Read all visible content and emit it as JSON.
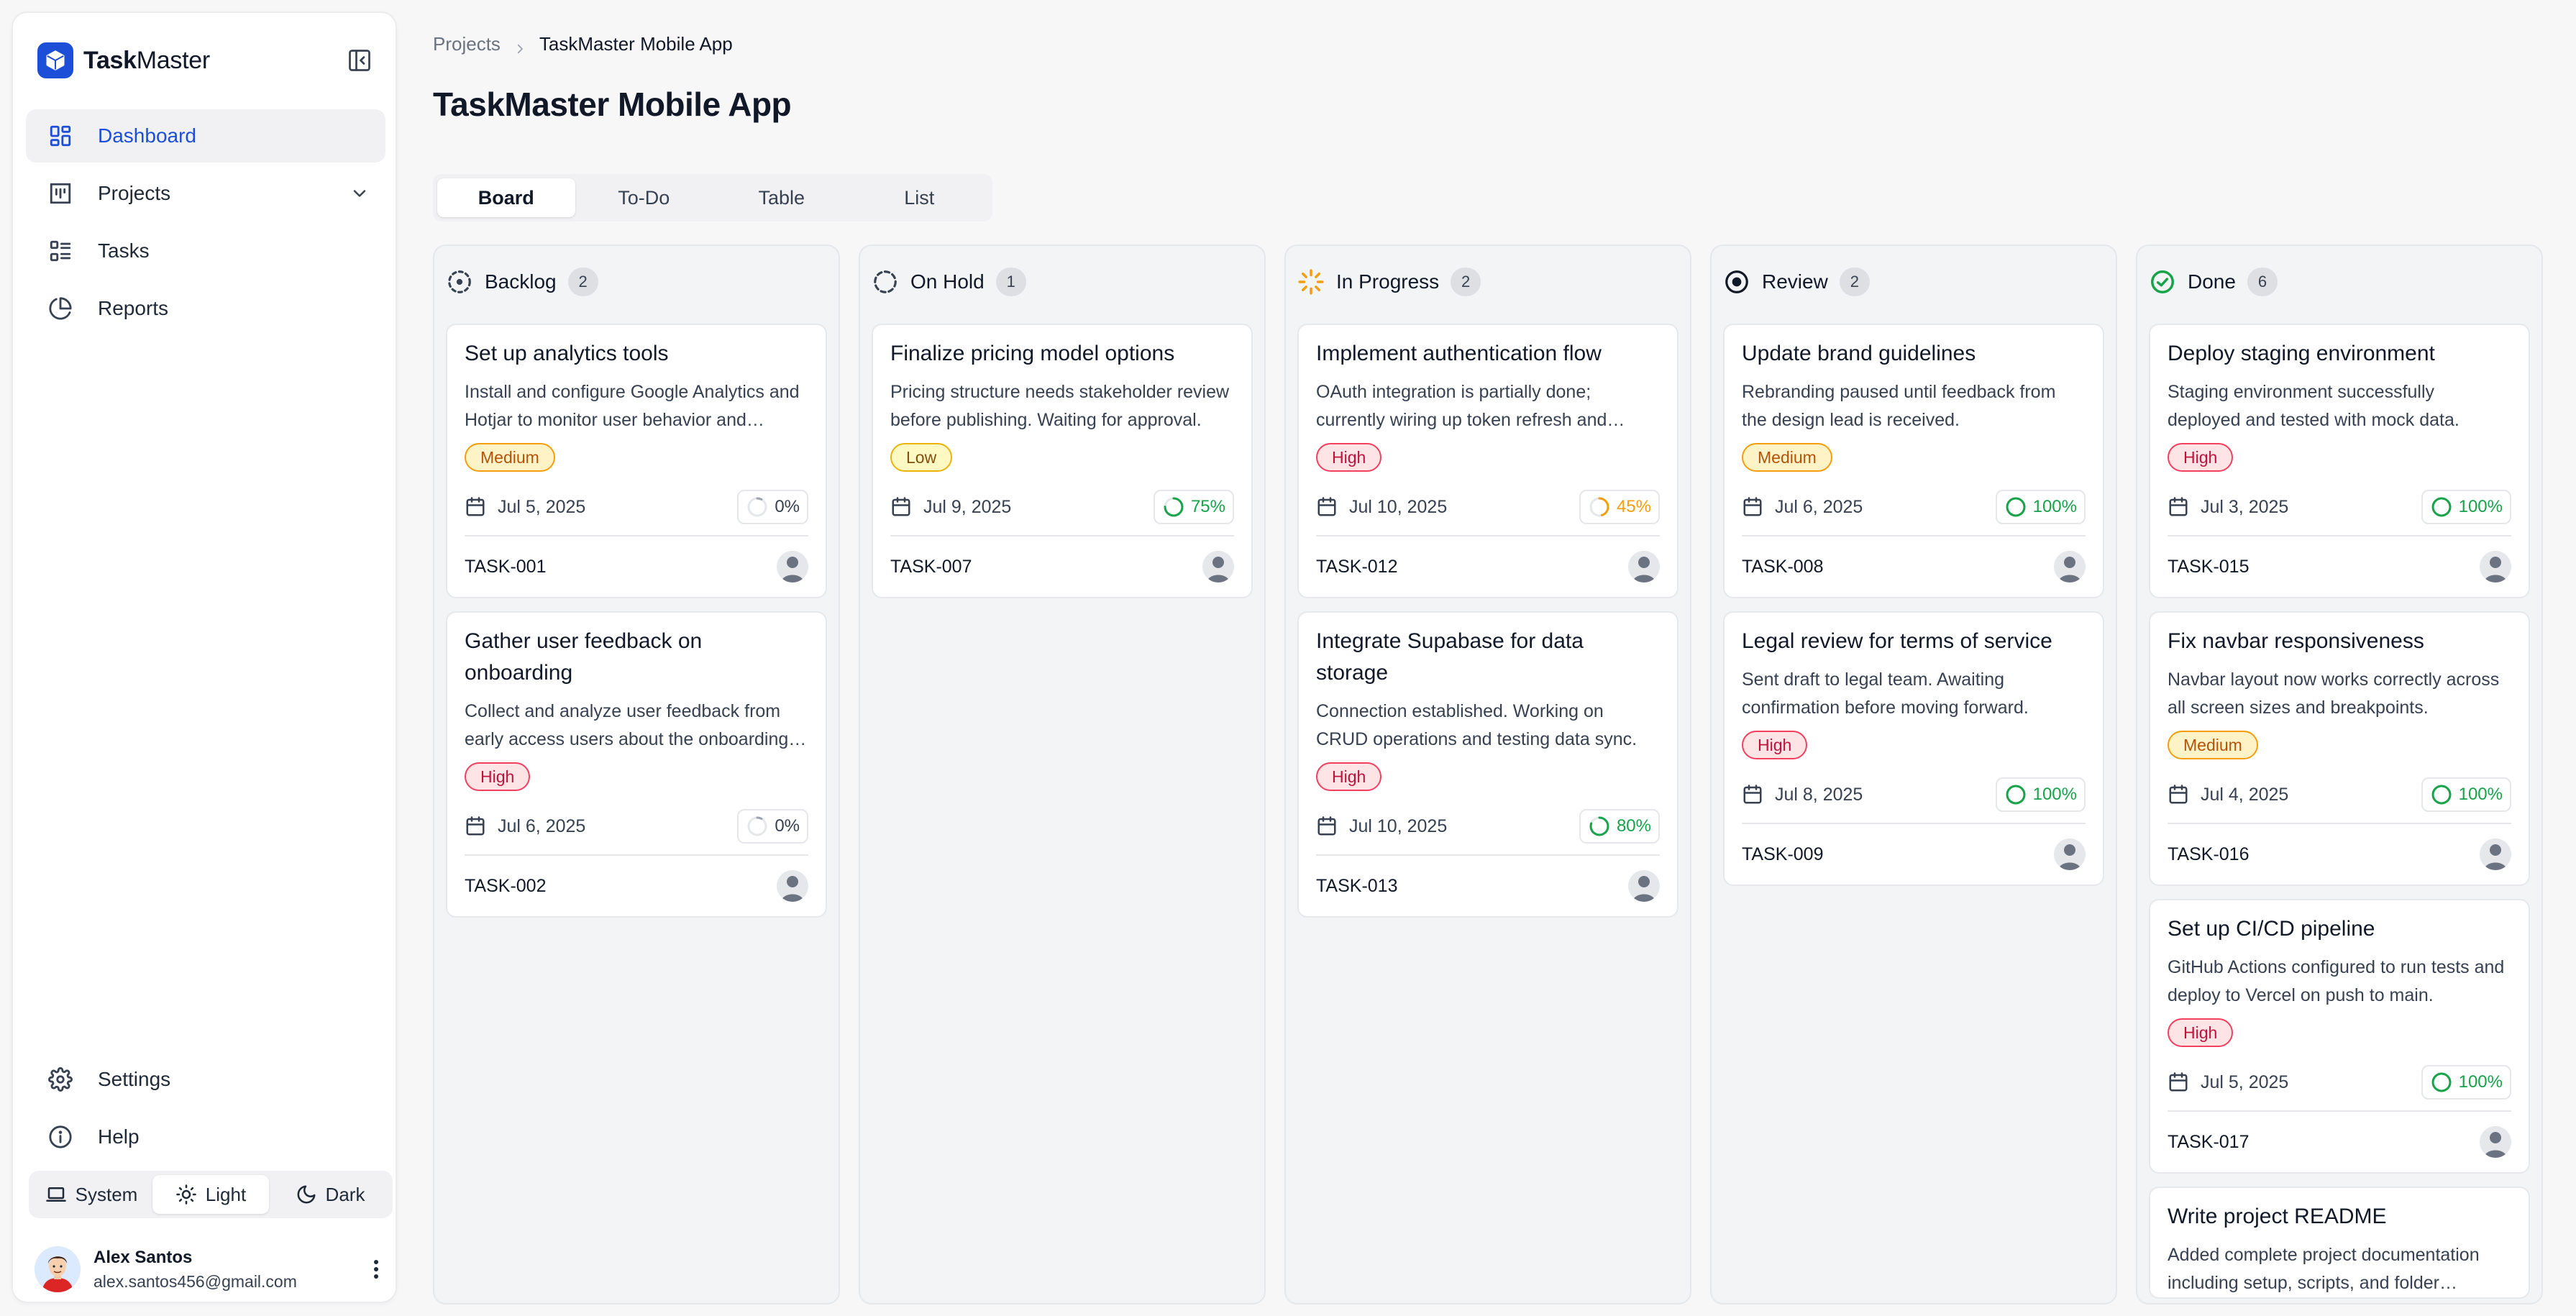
{
  "app": {
    "name_bold": "Task",
    "name_rest": "Master",
    "brand_color": "#1d4ed8"
  },
  "sidebar": {
    "items": [
      {
        "label": "Dashboard",
        "icon": "dashboard-icon",
        "active": true
      },
      {
        "label": "Projects",
        "icon": "projects-icon",
        "expandable": true
      },
      {
        "label": "Tasks",
        "icon": "tasks-icon"
      },
      {
        "label": "Reports",
        "icon": "reports-icon"
      }
    ],
    "bottom_items": [
      {
        "label": "Settings",
        "icon": "gear-icon"
      },
      {
        "label": "Help",
        "icon": "info-icon"
      }
    ],
    "theme": {
      "options": [
        "System",
        "Light",
        "Dark"
      ],
      "selected": "Light"
    },
    "user": {
      "name": "Alex Santos",
      "email": "alex.santos456@gmail.com"
    }
  },
  "breadcrumb": {
    "parent": "Projects",
    "current": "TaskMaster Mobile App"
  },
  "page": {
    "title": "TaskMaster Mobile App"
  },
  "tabs": [
    "Board",
    "To-Do",
    "Table",
    "List"
  ],
  "active_tab": "Board",
  "columns": [
    {
      "title": "Backlog",
      "count": "2",
      "status_icon": "backlog-icon",
      "cards": [
        {
          "title": "Set up analytics tools",
          "desc": "Install and configure Google Analytics and Hotjar to monitor user behavior and engagement metrics.",
          "priority": "Medium",
          "date": "Jul 5, 2025",
          "progress": "0%",
          "id": "TASK-001"
        },
        {
          "title": "Gather user feedback on onboarding",
          "desc": "Collect and analyze user feedback from early access users about the onboarding experience.",
          "priority": "High",
          "date": "Jul 6, 2025",
          "progress": "0%",
          "id": "TASK-002"
        }
      ]
    },
    {
      "title": "On Hold",
      "count": "1",
      "status_icon": "on-hold-icon",
      "cards": [
        {
          "title": "Finalize pricing model options",
          "desc": "Pricing structure needs stakeholder review before publishing. Waiting for approval.",
          "priority": "Low",
          "date": "Jul 9, 2025",
          "progress": "75%",
          "id": "TASK-007"
        }
      ]
    },
    {
      "title": "In Progress",
      "count": "2",
      "status_icon": "in-progress-icon",
      "cards": [
        {
          "title": "Implement authentication flow",
          "desc": "OAuth integration is partially done; currently wiring up token refresh and session handling.",
          "priority": "High",
          "date": "Jul 10, 2025",
          "progress": "45%",
          "id": "TASK-012"
        },
        {
          "title": "Integrate Supabase for data storage",
          "desc": "Connection established. Working on CRUD operations and testing data sync.",
          "priority": "High",
          "date": "Jul 10, 2025",
          "progress": "80%",
          "id": "TASK-013"
        }
      ]
    },
    {
      "title": "Review",
      "count": "2",
      "status_icon": "review-icon",
      "cards": [
        {
          "title": "Update brand guidelines",
          "desc": "Rebranding paused until feedback from the design lead is received.",
          "priority": "Medium",
          "date": "Jul 6, 2025",
          "progress": "100%",
          "id": "TASK-008"
        },
        {
          "title": "Legal review for terms of service",
          "desc": "Sent draft to legal team. Awaiting confirmation before moving forward.",
          "priority": "High",
          "date": "Jul 8, 2025",
          "progress": "100%",
          "id": "TASK-009"
        }
      ]
    },
    {
      "title": "Done",
      "count": "6",
      "status_icon": "done-icon",
      "cards": [
        {
          "title": "Deploy staging environment",
          "desc": "Staging environment successfully deployed and tested with mock data.",
          "priority": "High",
          "date": "Jul 3, 2025",
          "progress": "100%",
          "id": "TASK-015"
        },
        {
          "title": "Fix navbar responsiveness",
          "desc": "Navbar layout now works correctly across all screen sizes and breakpoints.",
          "priority": "Medium",
          "date": "Jul 4, 2025",
          "progress": "100%",
          "id": "TASK-016"
        },
        {
          "title": "Set up CI/CD pipeline",
          "desc": "GitHub Actions configured to run tests and deploy to Vercel on push to main.",
          "priority": "High",
          "date": "Jul 5, 2025",
          "progress": "100%",
          "id": "TASK-017"
        },
        {
          "title": "Write project README",
          "desc": "Added complete project documentation including setup, scripts, and folder structure.",
          "priority": "",
          "date": "",
          "progress": "",
          "id": ""
        }
      ]
    }
  ],
  "colors": {
    "accent": "#1d4ed8",
    "progress_zero": "#9ca3af",
    "progress_partial": "#f59e0b",
    "progress_good": "#16a34a",
    "done": "#16a34a"
  }
}
